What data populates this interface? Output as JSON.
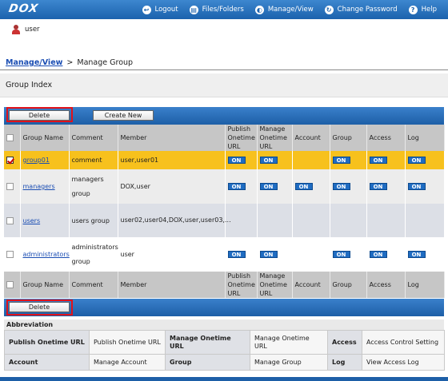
{
  "header": {
    "logo": "DOX",
    "nav": [
      {
        "label": "Logout",
        "icon": "logout-icon",
        "glyph": "↩"
      },
      {
        "label": "Files/Folders",
        "icon": "files-folders-icon",
        "glyph": "▤"
      },
      {
        "label": "Manage/View",
        "icon": "manage-view-icon",
        "glyph": "◐"
      },
      {
        "label": "Change Password",
        "icon": "change-password-icon",
        "glyph": "↻"
      },
      {
        "label": "Help",
        "icon": "help-icon",
        "glyph": "?"
      }
    ]
  },
  "user": {
    "name": "user"
  },
  "breadcrumb": {
    "parent": "Manage/View",
    "separator": ">",
    "current": "Manage Group"
  },
  "page_title": "Group Index",
  "actions": {
    "delete": "Delete",
    "create_new": "Create New"
  },
  "columns": {
    "group_name": "Group Name",
    "comment": "Comment",
    "member": "Member",
    "publish": "Publish Onetime URL",
    "manage": "Manage Onetime URL",
    "account": "Account",
    "group": "Group",
    "access": "Access",
    "log": "Log"
  },
  "on_label": "ON",
  "groups": [
    {
      "name": "group01",
      "comment": "comment",
      "member": "user,user01",
      "checked": true,
      "publish": true,
      "manage": true,
      "account": false,
      "group": true,
      "access": true,
      "log": true
    },
    {
      "name": "managers",
      "comment": "managers group",
      "member": "DOX,user",
      "checked": false,
      "publish": true,
      "manage": true,
      "account": true,
      "group": true,
      "access": true,
      "log": true
    },
    {
      "name": "users",
      "comment": "users group",
      "member": "user02,user04,DOX,user,user03,...",
      "checked": false,
      "publish": false,
      "manage": false,
      "account": false,
      "group": false,
      "access": false,
      "log": false
    },
    {
      "name": "administrators",
      "comment": "administrators group",
      "member": "user",
      "checked": false,
      "publish": true,
      "manage": true,
      "account": false,
      "group": true,
      "access": true,
      "log": true
    }
  ],
  "abbreviation": {
    "title": "Abbreviation",
    "rows": [
      [
        {
          "k": "Publish Onetime URL",
          "v": "Publish Onetime URL"
        },
        {
          "k": "Manage Onetime URL",
          "v": "Manage Onetime URL"
        },
        {
          "k": "Access",
          "v": "Access Control Setting"
        }
      ],
      [
        {
          "k": "Account",
          "v": "Manage Account"
        },
        {
          "k": "Group",
          "v": "Manage Group"
        },
        {
          "k": "Log",
          "v": "View Access Log"
        }
      ]
    ]
  },
  "colors": {
    "brand_blue": "#1d5fa7",
    "selected_row": "#f7c11d",
    "highlight": "#e0121b",
    "on_badge": "#1f6cc2"
  }
}
